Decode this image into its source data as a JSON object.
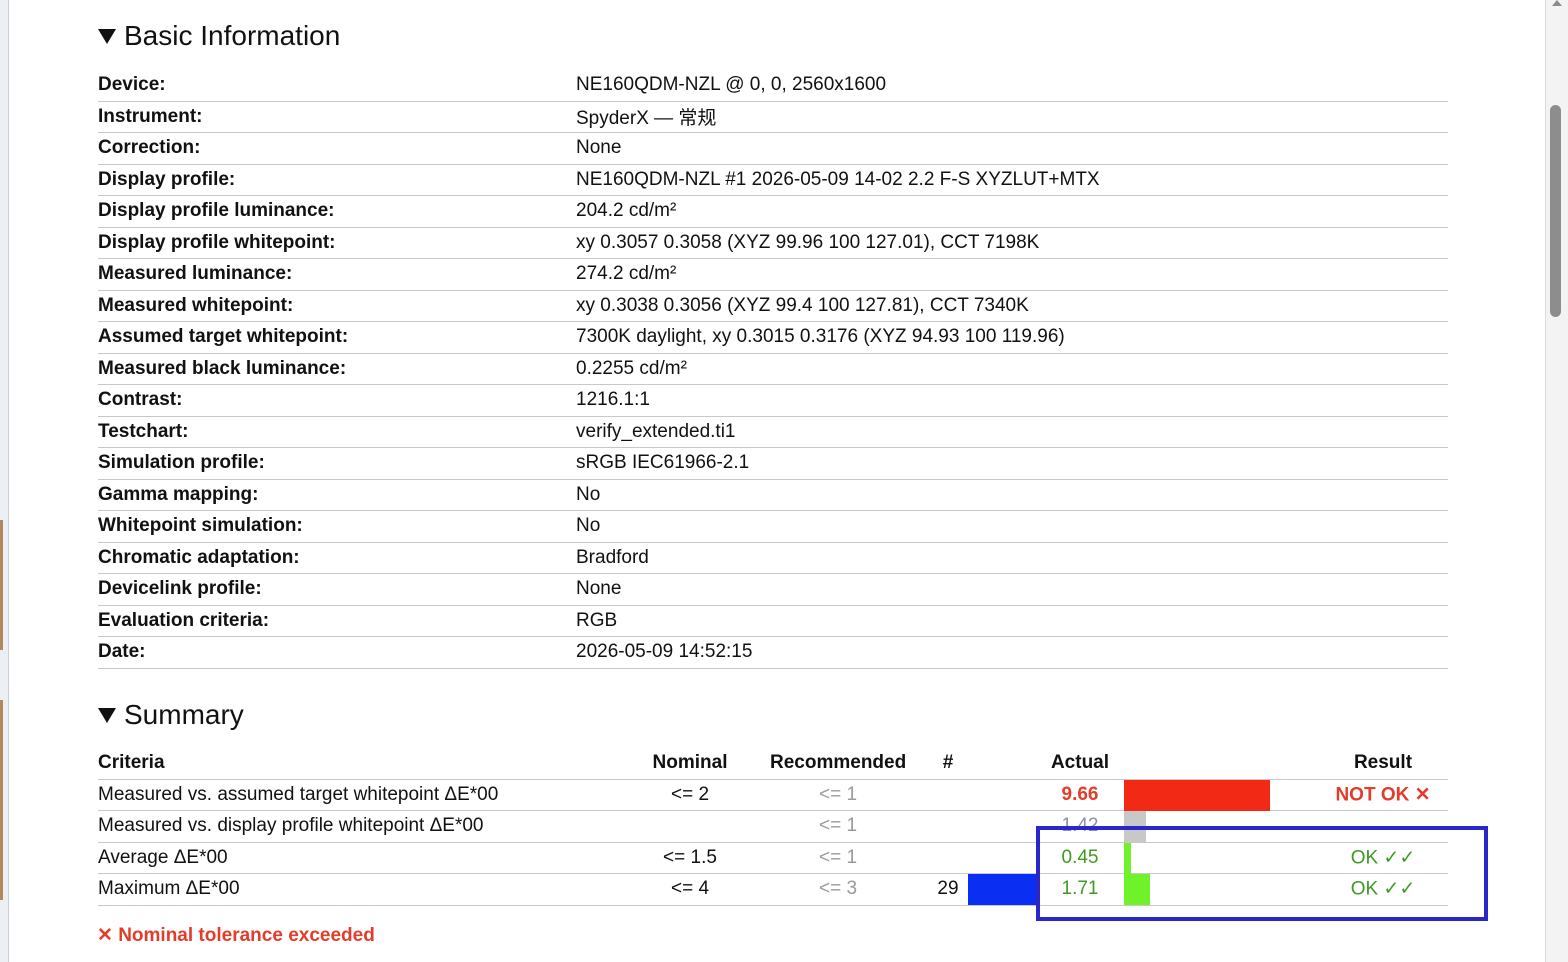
{
  "basic": {
    "heading": "Basic Information",
    "rows": [
      {
        "key": "Device:",
        "value": "NE160QDM-NZL @ 0, 0, 2560x1600"
      },
      {
        "key": "Instrument:",
        "value": "SpyderX — 常规"
      },
      {
        "key": "Correction:",
        "value": "None"
      },
      {
        "key": "Display profile:",
        "value": "NE160QDM-NZL #1 2026-05-09 14-02 2.2 F-S XYZLUT+MTX"
      },
      {
        "key": "Display profile luminance:",
        "value": "204.2 cd/m²"
      },
      {
        "key": "Display profile whitepoint:",
        "value": "xy 0.3057 0.3058 (XYZ 99.96 100 127.01), CCT 7198K"
      },
      {
        "key": "Measured luminance:",
        "value": "274.2 cd/m²"
      },
      {
        "key": "Measured whitepoint:",
        "value": "xy 0.3038 0.3056 (XYZ 99.4 100 127.81), CCT 7340K"
      },
      {
        "key": "Assumed target whitepoint:",
        "value": "7300K daylight, xy 0.3015 0.3176 (XYZ 94.93 100 119.96)"
      },
      {
        "key": "Measured black luminance:",
        "value": "0.2255 cd/m²"
      },
      {
        "key": "Contrast:",
        "value": "1216.1:1"
      },
      {
        "key": "Testchart:",
        "value": "verify_extended.ti1"
      },
      {
        "key": "Simulation profile:",
        "value": "sRGB IEC61966-2.1"
      },
      {
        "key": "Gamma mapping:",
        "value": "No"
      },
      {
        "key": "Whitepoint simulation:",
        "value": "No"
      },
      {
        "key": "Chromatic adaptation:",
        "value": "Bradford"
      },
      {
        "key": "Devicelink profile:",
        "value": "None"
      },
      {
        "key": "Evaluation criteria:",
        "value": "RGB"
      },
      {
        "key": "Date:",
        "value": "2026-05-09 14:52:15"
      }
    ]
  },
  "summary": {
    "heading": "Summary",
    "columns": {
      "criteria": "Criteria",
      "nominal": "Nominal",
      "recommended": "Recommended",
      "count": "#",
      "actual": "Actual",
      "result": "Result"
    },
    "rows": [
      {
        "criteria": "Measured vs. assumed target whitepoint ΔE*00",
        "nominal": "<= 2",
        "recommended": "<= 1",
        "count": "",
        "actual": "9.66",
        "result": "NOT OK ✕",
        "status": "fail",
        "actual_bar_fraction": 1.0,
        "actual_bar_color": "#f22a15"
      },
      {
        "criteria": "Measured vs. display profile whitepoint ΔE*00",
        "nominal": "",
        "recommended": "<= 1",
        "count": "",
        "actual": "1.42",
        "result": "",
        "status": "info",
        "actual_bar_fraction": 0.15,
        "actual_bar_color": "#c8c8c8"
      },
      {
        "criteria": "Average ΔE*00",
        "nominal": "<= 1.5",
        "recommended": "<= 1",
        "count": "",
        "actual": "0.45",
        "result": "OK ✓✓",
        "status": "pass",
        "actual_bar_fraction": 0.05,
        "actual_bar_color": "#70f22a"
      },
      {
        "criteria": "Maximum ΔE*00",
        "nominal": "<= 4",
        "recommended": "<= 3",
        "count": "29",
        "actual": "1.71",
        "result": "OK ✓✓",
        "status": "pass",
        "actual_bar_fraction": 0.18,
        "actual_bar_color": "#70f22a",
        "count_bar_color": "#0a2ff2"
      }
    ],
    "footnote": "✕ Nominal tolerance exceeded"
  }
}
